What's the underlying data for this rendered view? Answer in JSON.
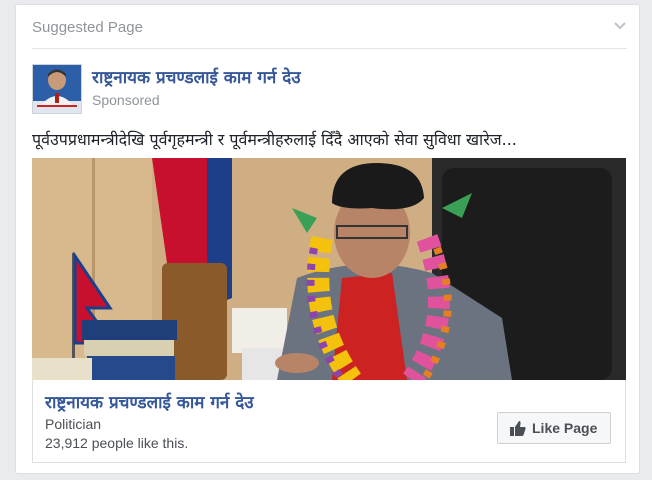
{
  "card": {
    "header_title": "Suggested Page",
    "page_name": "राष्ट्रनायक प्रचण्डलाई काम गर्न देउ",
    "sponsored": "Sponsored",
    "post_text": "पूर्वउपप्रधामन्त्रीदेखि पूर्वगृहमन्त्री र पूर्वमन्त्रीहरुलाई दिँदै आएको सेवा सुविधा खारेज...",
    "footer": {
      "title": "राष्ट्रनायक प्रचण्डलाई काम गर्न देउ",
      "category": "Politician",
      "like_count": "23,912 people like this.",
      "like_button_label": "Like Page"
    }
  },
  "icons": {
    "chevron": "chevron-down-icon",
    "thumb": "thumbs-up-icon"
  },
  "colors": {
    "link": "#365899",
    "muted": "#90949c",
    "text": "#1d2129",
    "background": "#e9ebee"
  }
}
